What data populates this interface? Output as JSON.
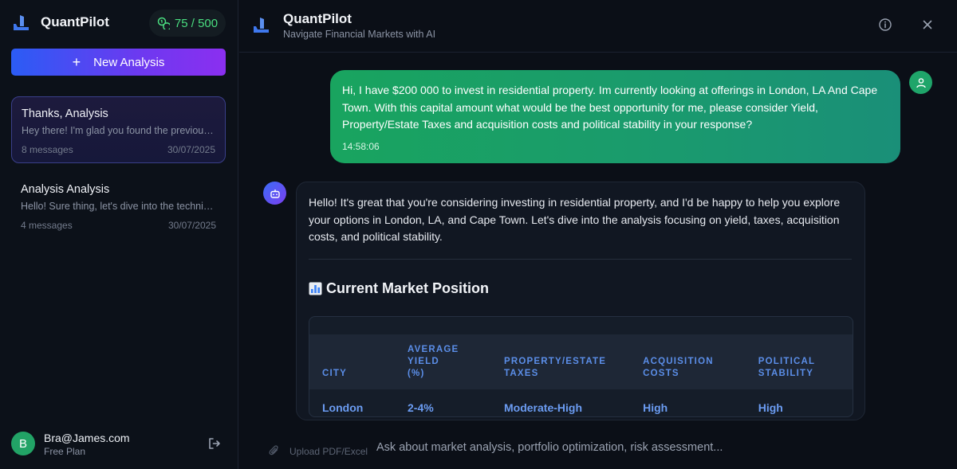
{
  "app": {
    "name": "QuantPilot"
  },
  "sidebar": {
    "credits": "75 / 500",
    "new_button_label": "New Analysis",
    "conversations": [
      {
        "title": "Thanks, Analysis",
        "snippet": "Hey there! I'm glad you found the previous i...",
        "count": "8 messages",
        "date": "30/07/2025",
        "active": true
      },
      {
        "title": "Analysis Analysis",
        "snippet": "Hello! Sure thing, let's dive into the technica...",
        "count": "4 messages",
        "date": "30/07/2025",
        "active": false
      }
    ],
    "user": {
      "initial": "B",
      "email": "Bra@James.com",
      "plan": "Free Plan"
    }
  },
  "header": {
    "title": "QuantPilot",
    "subtitle": "Navigate Financial Markets with AI"
  },
  "messages": {
    "user": {
      "text": "Hi, I have $200 000 to invest in residential property. Im currently looking at offerings in London, LA And Cape Town. With this capital amount what would be the best opportunity for me, please consider Yield, Property/Estate Taxes and acquisition costs and political stability in your response?",
      "time": "14:58:06"
    },
    "assistant": {
      "intro": "Hello! It's great that you're considering investing in residential property, and I'd be happy to help you explore your options in London, LA, and Cape Town. Let's dive into the analysis focusing on yield, taxes, acquisition costs, and political stability.",
      "heading": "Current Market Position",
      "table": {
        "headers": [
          "CITY",
          "AVERAGE YIELD (%)",
          "PROPERTY/ESTATE TAXES",
          "ACQUISITION COSTS",
          "POLITICAL STABILITY"
        ],
        "rows": [
          [
            "London",
            "2-4%",
            "Moderate-High",
            "High",
            "High"
          ]
        ]
      }
    }
  },
  "composer": {
    "upload_label": "Upload PDF/Excel",
    "placeholder": "Ask about market analysis, portfolio optimization, risk assessment..."
  },
  "colors": {
    "accent_green": "#19a45f",
    "accent_blue": "#2b5cf5",
    "accent_purple": "#8b2ff0",
    "table_text": "#6b9cf2"
  }
}
